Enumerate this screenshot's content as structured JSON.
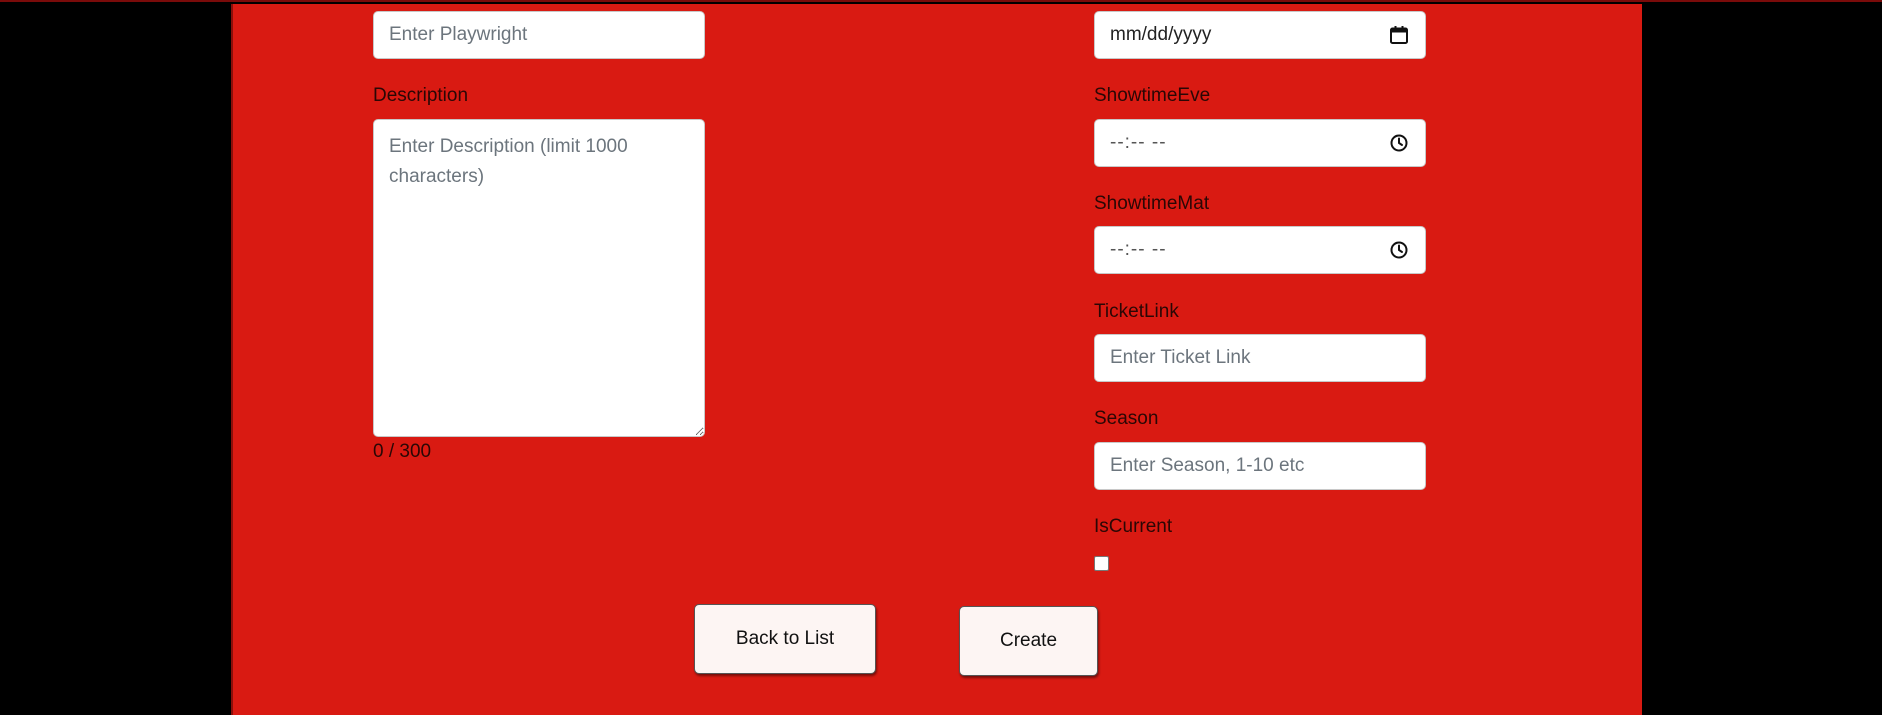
{
  "form": {
    "playwright": {
      "placeholder": "Enter Playwright",
      "value": ""
    },
    "description": {
      "label": "Description",
      "placeholder": "Enter Description (limit 1000 characters)",
      "value": "",
      "counter": "0 / 300"
    },
    "date": {
      "value_display": "mm/dd/yyyy",
      "icon": "calendar-icon"
    },
    "showtime_eve": {
      "label": "ShowtimeEve",
      "value_display": "--:-- --",
      "icon": "clock-icon"
    },
    "showtime_mat": {
      "label": "ShowtimeMat",
      "value_display": "--:-- --",
      "icon": "clock-icon"
    },
    "ticket_link": {
      "label": "TicketLink",
      "placeholder": "Enter Ticket Link",
      "value": ""
    },
    "season": {
      "label": "Season",
      "placeholder": "Enter Season, 1-10 etc",
      "value": ""
    },
    "is_current": {
      "label": "IsCurrent",
      "checked": false
    }
  },
  "actions": {
    "back_label": "Back to List",
    "create_label": "Create"
  },
  "colors": {
    "panel_background": "#d91a12",
    "page_background": "#000000",
    "button_background": "#fdf5f3"
  }
}
